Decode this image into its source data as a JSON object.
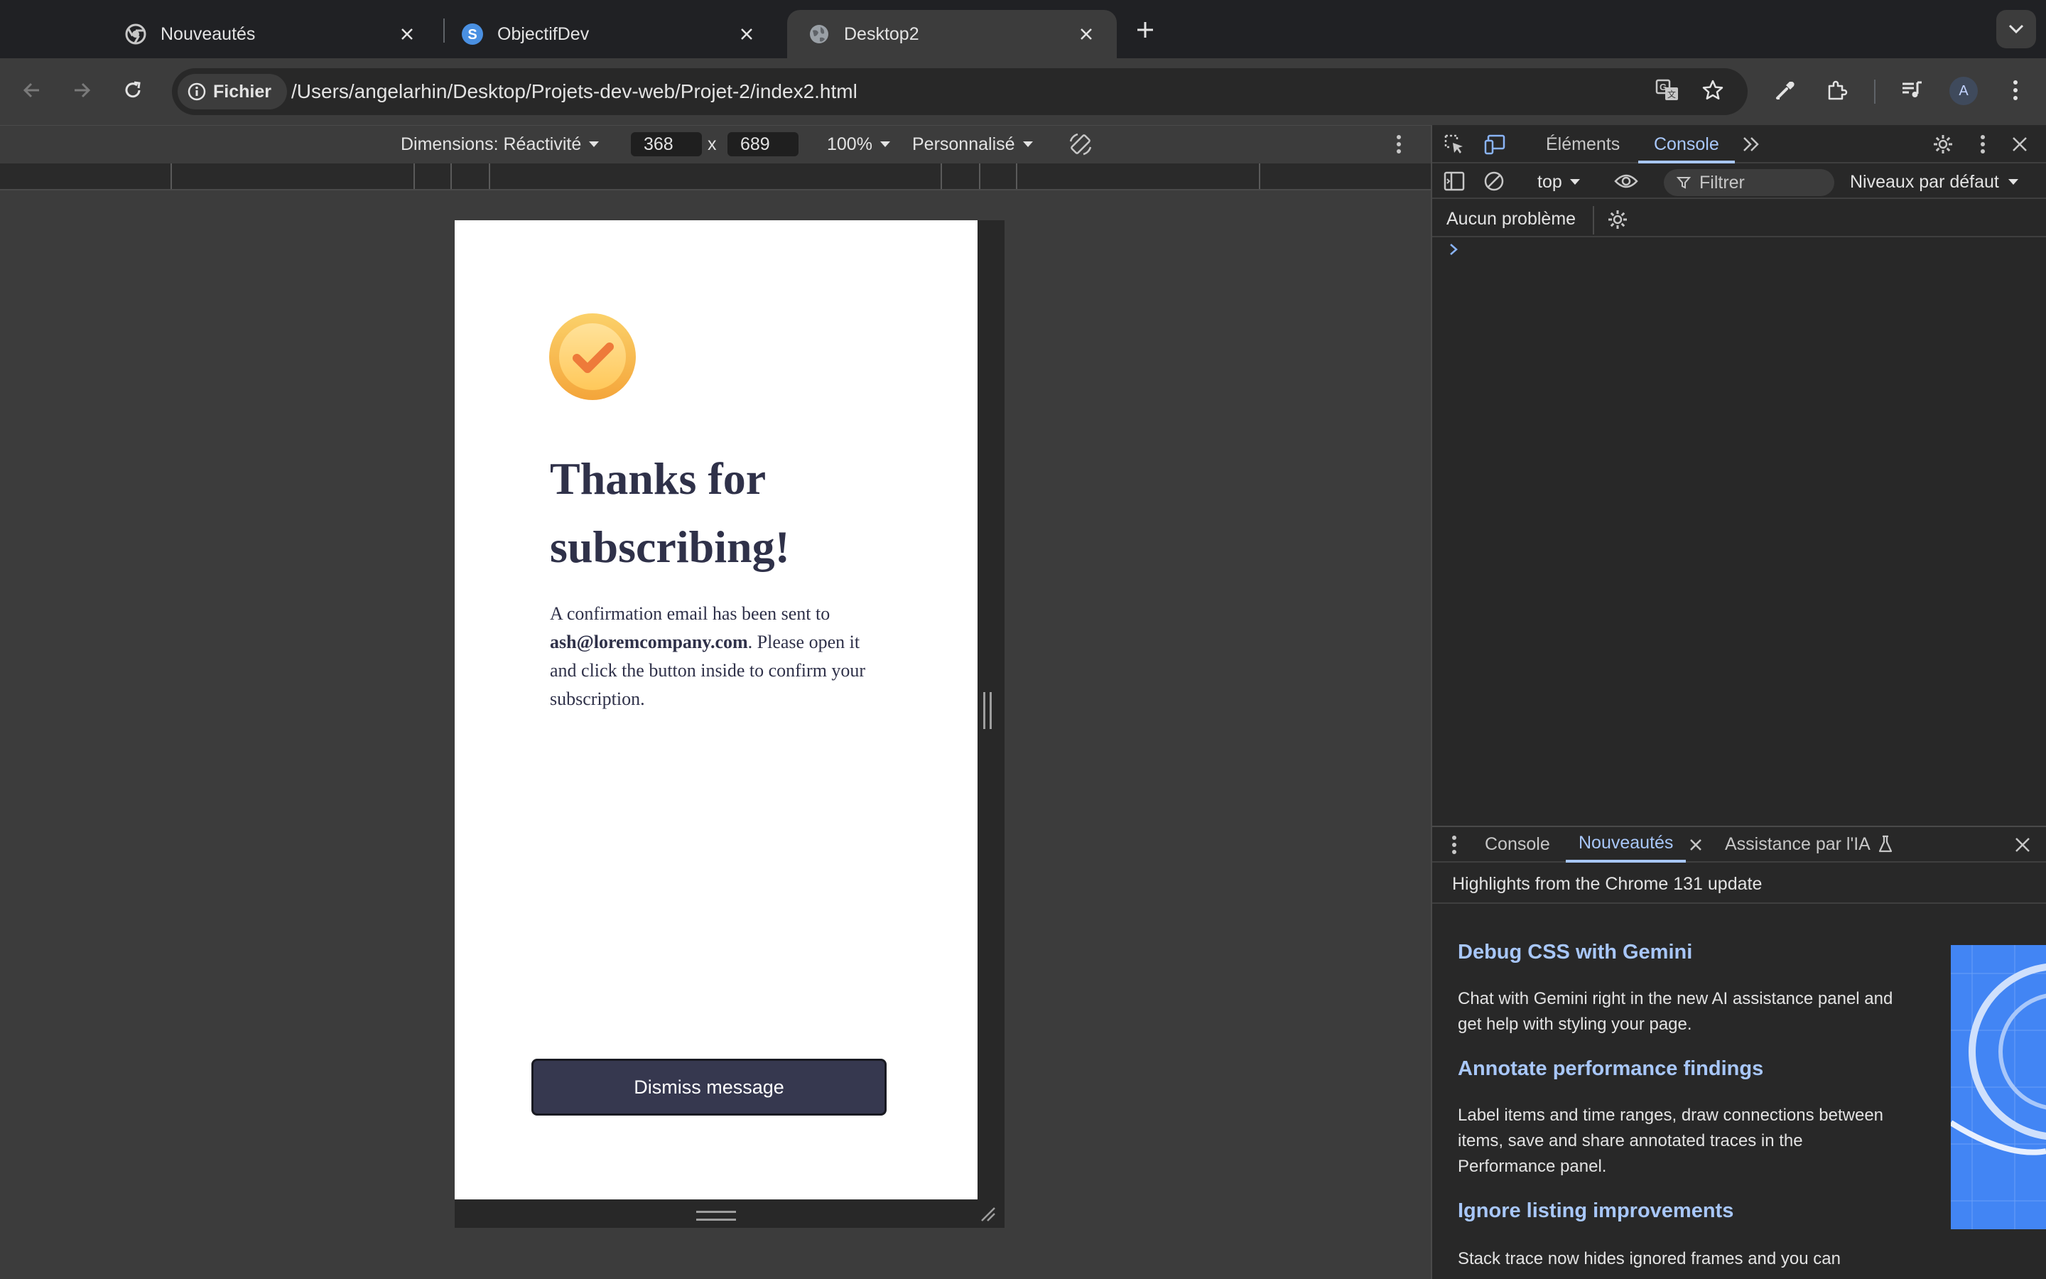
{
  "browser": {
    "tabs": [
      {
        "title": "Nouveautés",
        "icon": "chrome-icon",
        "active": false
      },
      {
        "title": "ObjectifDev",
        "icon": "objectifdev-s-icon",
        "active": false
      },
      {
        "title": "Desktop2",
        "icon": "globe-icon",
        "active": true
      }
    ],
    "address": {
      "chip_label": "Fichier",
      "url": "/Users/angelarhin/Desktop/Projets-dev-web/Projet-2/index2.html"
    },
    "profile_initial": "A"
  },
  "device_toolbar": {
    "dimensions_label": "Dimensions: Réactivité",
    "width": "368",
    "times": "x",
    "height": "689",
    "zoom": "100%",
    "throttle": "Personnalisé"
  },
  "page": {
    "title": "Thanks for subscribing!",
    "desc_before": "A confirmation email has been sent to ",
    "email": "ash@loremcompany.com",
    "desc_after": ". Please open it and click the button inside to confirm your subscription.",
    "button_label": "Dismiss message",
    "colors": {
      "dark_navy": "#36384f",
      "text": "#2f3149",
      "icon_orange": "#f5a623"
    }
  },
  "devtools": {
    "tabs": {
      "elements": "Éléments",
      "console": "Console"
    },
    "console": {
      "context": "top",
      "filter_placeholder": "Filtrer",
      "levels": "Niveaux par défaut",
      "issues": "Aucun problème"
    },
    "drawer": {
      "tabs": {
        "console": "Console",
        "whats_new": "Nouveautés",
        "ai": "Assistance par l'IA"
      },
      "header": "Highlights from the Chrome 131 update",
      "features": [
        {
          "title": "Debug CSS with Gemini",
          "text": "Chat with Gemini right in the new AI assistance panel and get help with styling your page."
        },
        {
          "title": "Annotate performance findings",
          "text": "Label items and time ranges, draw connections between items, save and share annotated traces in the Performance panel."
        },
        {
          "title": "Ignore listing improvements",
          "text": "Stack trace now hides ignored frames and you can"
        }
      ]
    }
  }
}
